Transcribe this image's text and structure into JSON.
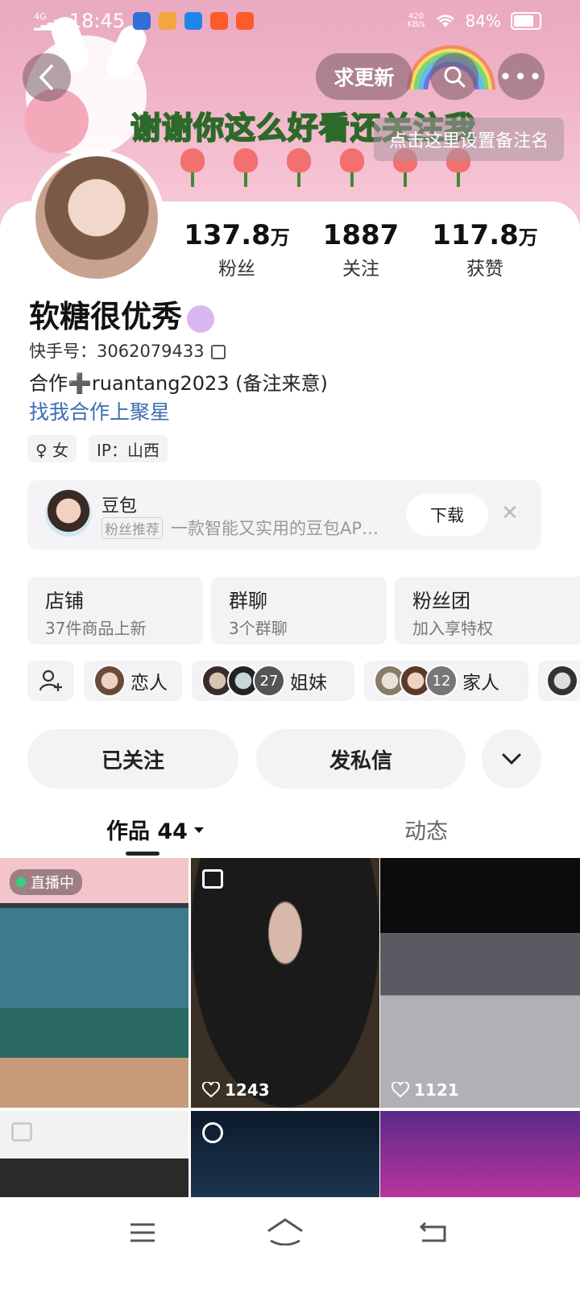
{
  "status_bar": {
    "network": "4G HD",
    "time": "18:45",
    "speed": "420\nKB/s",
    "battery": "84%"
  },
  "header": {
    "update_button": "求更新",
    "banner_text": "谢谢你这么好看还关注我",
    "note_button": "点击这里设置备注名"
  },
  "profile": {
    "stats": [
      {
        "value": "137.8",
        "unit": "万",
        "label": "粉丝"
      },
      {
        "value": "1887",
        "unit": "",
        "label": "关注"
      },
      {
        "value": "117.8",
        "unit": "万",
        "label": "获赞"
      }
    ],
    "name": "软糖很优秀",
    "kuaishou_id": "快手号：3062079433",
    "bio": "合作➕ruantang2023 (备注来意)",
    "collab_link": "找我合作上聚星",
    "tags": [
      "♀ 女",
      "IP：山西"
    ]
  },
  "ad": {
    "title": "豆包",
    "badge": "粉丝推荐",
    "description": "一款智能又实用的豆包AP…",
    "button": "下载"
  },
  "features": [
    {
      "title": "店铺",
      "subtitle": "37件商品上新"
    },
    {
      "title": "群聊",
      "subtitle": "3个群聊"
    },
    {
      "title": "粉丝团",
      "subtitle": "加入享特权"
    }
  ],
  "relations": [
    {
      "label": "恋人"
    },
    {
      "label": "姐妹",
      "count": "27"
    },
    {
      "label": "家人",
      "count": "12"
    }
  ],
  "actions": {
    "follow": "已关注",
    "message": "发私信"
  },
  "tabs": {
    "works": "作品 44",
    "dynamic": "动态"
  },
  "grid": {
    "live_badge": "直播中",
    "likes": [
      "1243",
      "1121"
    ]
  },
  "colors": {
    "accent_link": "#3c6db4",
    "banner_pink": "#f0b3c8",
    "banner_text": "#f6e94b"
  }
}
